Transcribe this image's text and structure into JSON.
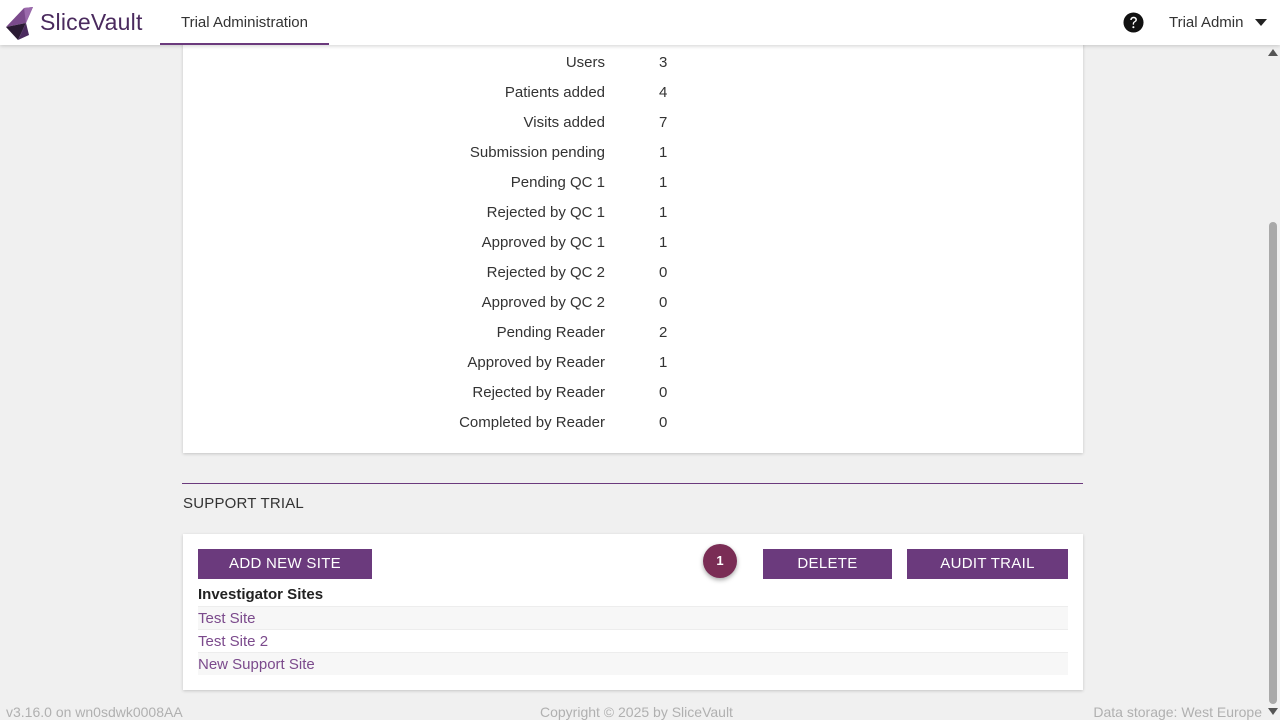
{
  "header": {
    "brand": "SliceVault",
    "nav_tab": "Trial Administration",
    "user": "Trial Admin"
  },
  "stats": [
    {
      "label": "Users",
      "value": "3"
    },
    {
      "label": "Patients added",
      "value": "4"
    },
    {
      "label": "Visits added",
      "value": "7"
    },
    {
      "label": "Submission pending",
      "value": "1"
    },
    {
      "label": "Pending QC 1",
      "value": "1"
    },
    {
      "label": "Rejected by QC 1",
      "value": "1"
    },
    {
      "label": "Approved by QC 1",
      "value": "1"
    },
    {
      "label": "Rejected by QC 2",
      "value": "0"
    },
    {
      "label": "Approved by QC 2",
      "value": "0"
    },
    {
      "label": "Pending Reader",
      "value": "2"
    },
    {
      "label": "Approved by Reader",
      "value": "1"
    },
    {
      "label": "Rejected by Reader",
      "value": "0"
    },
    {
      "label": "Completed by Reader",
      "value": "0"
    }
  ],
  "support": {
    "title": "SUPPORT TRIAL",
    "add_button": "ADD NEW SITE",
    "badge": "1",
    "delete_button": "DELETE",
    "audit_button": "AUDIT TRAIL",
    "sites_heading": "Investigator Sites",
    "sites": [
      "Test Site",
      "Test Site 2",
      "New Support Site"
    ]
  },
  "footer": {
    "version": "v3.16.0 on wn0sdwk0008AA",
    "copyright": "Copyright © 2025 by SliceVault",
    "storage": "Data storage: West Europe"
  },
  "colors": {
    "accent": "#6b3a7d",
    "badge": "#7a2d55",
    "link": "#7b4a8c"
  },
  "icons": {
    "logo": "slicevault-logo-icon",
    "help": "question-circle-icon",
    "caret": "caret-down-icon"
  }
}
